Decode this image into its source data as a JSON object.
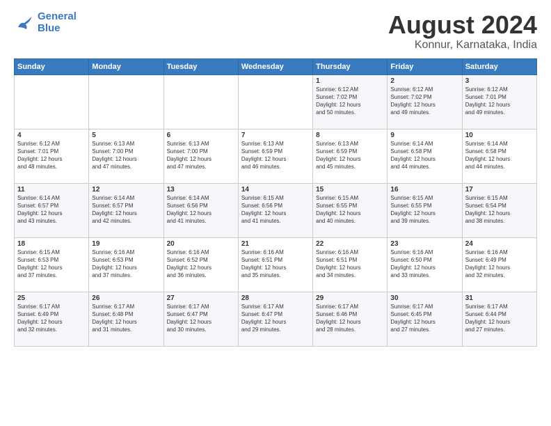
{
  "logo": {
    "line1": "General",
    "line2": "Blue"
  },
  "header": {
    "title": "August 2024",
    "subtitle": "Konnur, Karnataka, India"
  },
  "weekdays": [
    "Sunday",
    "Monday",
    "Tuesday",
    "Wednesday",
    "Thursday",
    "Friday",
    "Saturday"
  ],
  "weeks": [
    [
      {
        "day": "",
        "info": ""
      },
      {
        "day": "",
        "info": ""
      },
      {
        "day": "",
        "info": ""
      },
      {
        "day": "",
        "info": ""
      },
      {
        "day": "1",
        "info": "Sunrise: 6:12 AM\nSunset: 7:02 PM\nDaylight: 12 hours\nand 50 minutes."
      },
      {
        "day": "2",
        "info": "Sunrise: 6:12 AM\nSunset: 7:02 PM\nDaylight: 12 hours\nand 49 minutes."
      },
      {
        "day": "3",
        "info": "Sunrise: 6:12 AM\nSunset: 7:01 PM\nDaylight: 12 hours\nand 49 minutes."
      }
    ],
    [
      {
        "day": "4",
        "info": "Sunrise: 6:12 AM\nSunset: 7:01 PM\nDaylight: 12 hours\nand 48 minutes."
      },
      {
        "day": "5",
        "info": "Sunrise: 6:13 AM\nSunset: 7:00 PM\nDaylight: 12 hours\nand 47 minutes."
      },
      {
        "day": "6",
        "info": "Sunrise: 6:13 AM\nSunset: 7:00 PM\nDaylight: 12 hours\nand 47 minutes."
      },
      {
        "day": "7",
        "info": "Sunrise: 6:13 AM\nSunset: 6:59 PM\nDaylight: 12 hours\nand 46 minutes."
      },
      {
        "day": "8",
        "info": "Sunrise: 6:13 AM\nSunset: 6:59 PM\nDaylight: 12 hours\nand 45 minutes."
      },
      {
        "day": "9",
        "info": "Sunrise: 6:14 AM\nSunset: 6:58 PM\nDaylight: 12 hours\nand 44 minutes."
      },
      {
        "day": "10",
        "info": "Sunrise: 6:14 AM\nSunset: 6:58 PM\nDaylight: 12 hours\nand 44 minutes."
      }
    ],
    [
      {
        "day": "11",
        "info": "Sunrise: 6:14 AM\nSunset: 6:57 PM\nDaylight: 12 hours\nand 43 minutes."
      },
      {
        "day": "12",
        "info": "Sunrise: 6:14 AM\nSunset: 6:57 PM\nDaylight: 12 hours\nand 42 minutes."
      },
      {
        "day": "13",
        "info": "Sunrise: 6:14 AM\nSunset: 6:56 PM\nDaylight: 12 hours\nand 41 minutes."
      },
      {
        "day": "14",
        "info": "Sunrise: 6:15 AM\nSunset: 6:56 PM\nDaylight: 12 hours\nand 41 minutes."
      },
      {
        "day": "15",
        "info": "Sunrise: 6:15 AM\nSunset: 6:55 PM\nDaylight: 12 hours\nand 40 minutes."
      },
      {
        "day": "16",
        "info": "Sunrise: 6:15 AM\nSunset: 6:55 PM\nDaylight: 12 hours\nand 39 minutes."
      },
      {
        "day": "17",
        "info": "Sunrise: 6:15 AM\nSunset: 6:54 PM\nDaylight: 12 hours\nand 38 minutes."
      }
    ],
    [
      {
        "day": "18",
        "info": "Sunrise: 6:15 AM\nSunset: 6:53 PM\nDaylight: 12 hours\nand 37 minutes."
      },
      {
        "day": "19",
        "info": "Sunrise: 6:16 AM\nSunset: 6:53 PM\nDaylight: 12 hours\nand 37 minutes."
      },
      {
        "day": "20",
        "info": "Sunrise: 6:16 AM\nSunset: 6:52 PM\nDaylight: 12 hours\nand 36 minutes."
      },
      {
        "day": "21",
        "info": "Sunrise: 6:16 AM\nSunset: 6:51 PM\nDaylight: 12 hours\nand 35 minutes."
      },
      {
        "day": "22",
        "info": "Sunrise: 6:16 AM\nSunset: 6:51 PM\nDaylight: 12 hours\nand 34 minutes."
      },
      {
        "day": "23",
        "info": "Sunrise: 6:16 AM\nSunset: 6:50 PM\nDaylight: 12 hours\nand 33 minutes."
      },
      {
        "day": "24",
        "info": "Sunrise: 6:16 AM\nSunset: 6:49 PM\nDaylight: 12 hours\nand 32 minutes."
      }
    ],
    [
      {
        "day": "25",
        "info": "Sunrise: 6:17 AM\nSunset: 6:49 PM\nDaylight: 12 hours\nand 32 minutes."
      },
      {
        "day": "26",
        "info": "Sunrise: 6:17 AM\nSunset: 6:48 PM\nDaylight: 12 hours\nand 31 minutes."
      },
      {
        "day": "27",
        "info": "Sunrise: 6:17 AM\nSunset: 6:47 PM\nDaylight: 12 hours\nand 30 minutes."
      },
      {
        "day": "28",
        "info": "Sunrise: 6:17 AM\nSunset: 6:47 PM\nDaylight: 12 hours\nand 29 minutes."
      },
      {
        "day": "29",
        "info": "Sunrise: 6:17 AM\nSunset: 6:46 PM\nDaylight: 12 hours\nand 28 minutes."
      },
      {
        "day": "30",
        "info": "Sunrise: 6:17 AM\nSunset: 6:45 PM\nDaylight: 12 hours\nand 27 minutes."
      },
      {
        "day": "31",
        "info": "Sunrise: 6:17 AM\nSunset: 6:44 PM\nDaylight: 12 hours\nand 27 minutes."
      }
    ]
  ]
}
